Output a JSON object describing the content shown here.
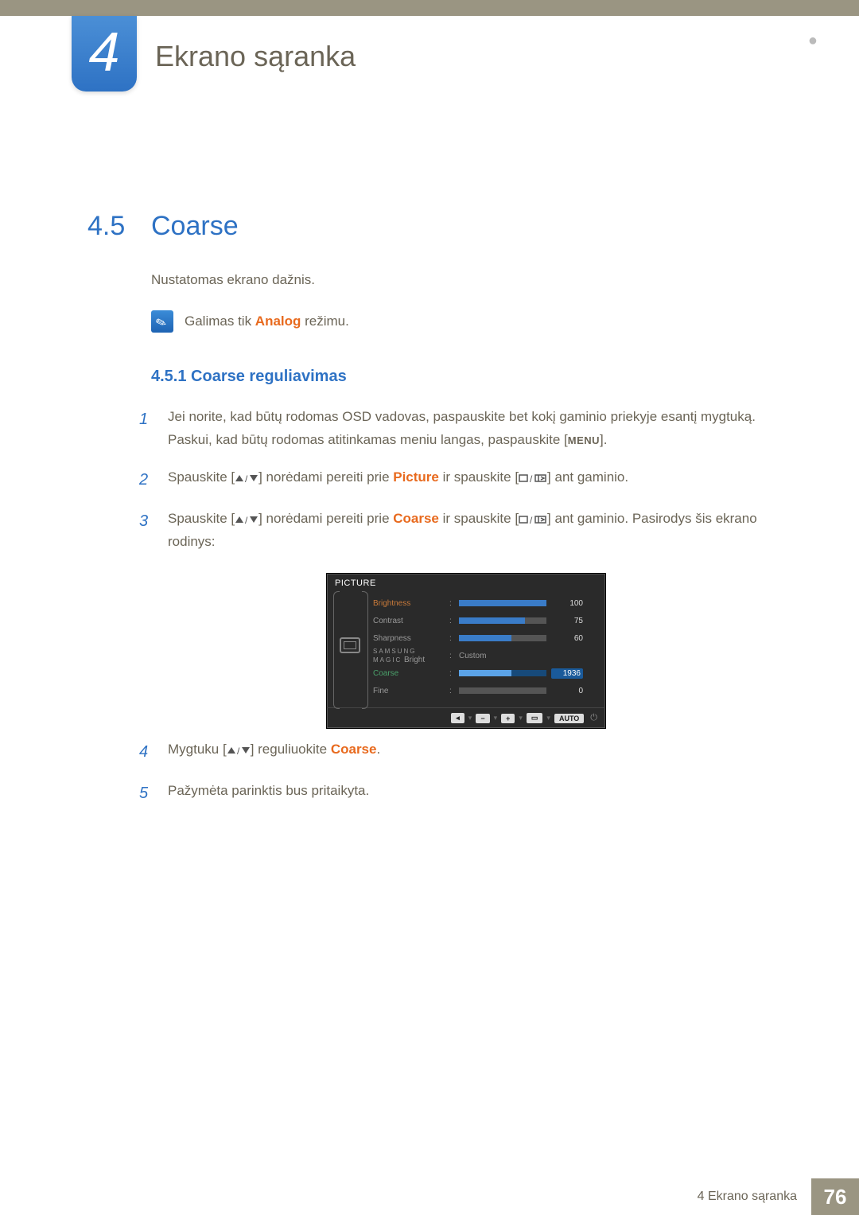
{
  "chapter": {
    "number": "4",
    "title": "Ekrano sąranka"
  },
  "section": {
    "number": "4.5",
    "title": "Coarse"
  },
  "intro": "Nustatomas ekrano dažnis.",
  "note": {
    "pre": "Galimas tik ",
    "hl": "Analog",
    "post": " režimu."
  },
  "subsection": "4.5.1  Coarse reguliavimas",
  "steps": {
    "s1": {
      "num": "1",
      "line1": "Jei norite, kad būtų rodomas OSD vadovas, paspauskite bet kokį gaminio priekyje esantį mygtuką.",
      "line2a": "Paskui, kad būtų rodomas atitinkamas meniu langas, paspauskite [",
      "menu": "MENU",
      "line2b": "]."
    },
    "s2": {
      "num": "2",
      "a": "Spauskite [",
      "b": "] norėdami pereiti prie ",
      "hl": "Picture",
      "c": " ir spauskite [",
      "d": "] ant gaminio."
    },
    "s3": {
      "num": "3",
      "a": "Spauskite [",
      "b": "] norėdami pereiti prie ",
      "hl": "Coarse",
      "c": " ir spauskite [",
      "d": "] ant gaminio. Pasirodys šis ekrano rodinys:"
    },
    "s4": {
      "num": "4",
      "a": "Mygtuku [",
      "b": "] reguliuokite ",
      "hl": "Coarse",
      "c": "."
    },
    "s5": {
      "num": "5",
      "text": "Pažymėta parinktis bus pritaikyta."
    }
  },
  "osd": {
    "title": "PICTURE",
    "rows": [
      {
        "label": "Brightness",
        "value": "100",
        "fill": 100,
        "grey": false
      },
      {
        "label": "Contrast",
        "value": "75",
        "fill": 75,
        "grey": true
      },
      {
        "label": "Sharpness",
        "value": "60",
        "fill": 60,
        "grey": true
      }
    ],
    "magic": {
      "top": "SAMSUNG",
      "bottom": "MAGIC",
      "suffix": "Bright",
      "value": "Custom"
    },
    "coarse": {
      "label": "Coarse",
      "value": "1936",
      "fill": 60
    },
    "fine": {
      "label": "Fine",
      "value": "0",
      "fill": 0
    },
    "footer": {
      "auto": "AUTO"
    }
  },
  "footer": {
    "text": "4 Ekrano sąranka",
    "page": "76"
  }
}
